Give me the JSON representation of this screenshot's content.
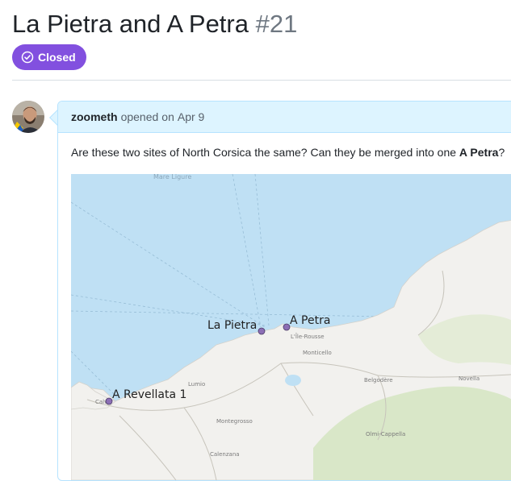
{
  "issue": {
    "title": "La Pietra and A Petra",
    "number": "#21",
    "state": "Closed",
    "state_color": "#8250df"
  },
  "comment": {
    "author": "zoometh",
    "action": "opened",
    "date_prefix": "on",
    "date": "Apr 9",
    "body_text": "Are these two sites of North Corsica the same? Can they be merged into one ",
    "body_bold": "A Petra",
    "body_end": "?"
  },
  "map": {
    "sea_label": "Mare Ligure",
    "sites": [
      {
        "name": "La Pietra"
      },
      {
        "name": "A Petra"
      },
      {
        "name": "A Revellata 1"
      }
    ],
    "places": [
      "L'Île-Rousse",
      "Monticello",
      "Belgodère",
      "Novella",
      "Lumio",
      "Calvi",
      "Montegrosso",
      "Olmi-Cappella",
      "Calenzana"
    ],
    "colors": {
      "sea": "#bfe0f4",
      "land": "#f2f1ee",
      "hills": "#d9e7c8",
      "site": "#8c6fb5"
    }
  }
}
